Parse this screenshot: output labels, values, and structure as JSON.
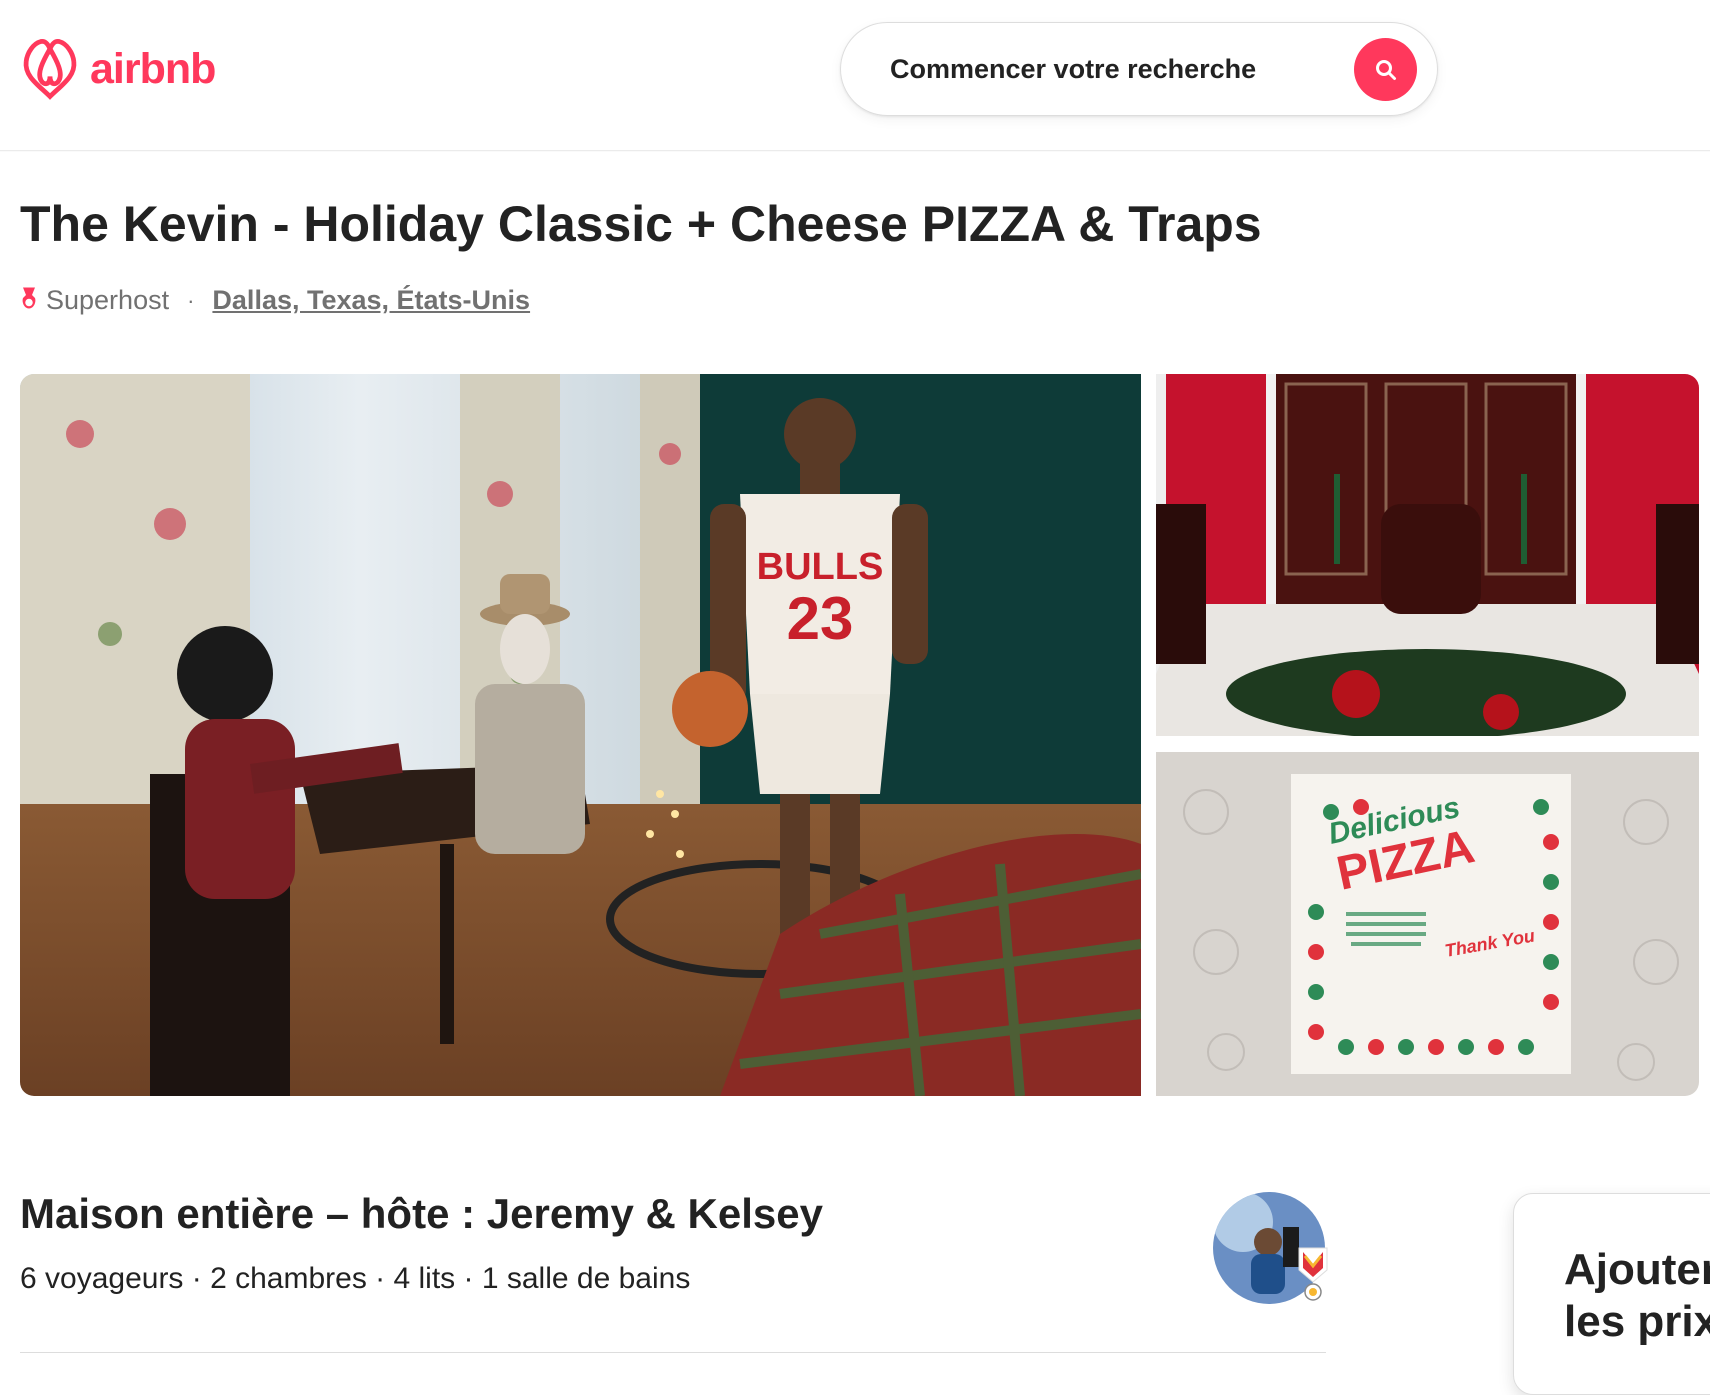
{
  "header": {
    "logo_text": "airbnb",
    "search_label": "Commencer votre recherche"
  },
  "listing": {
    "title": "The Kevin - Holiday Classic + Cheese PIZZA & Traps",
    "superhost_label": "Superhost",
    "separator": "·",
    "location": "Dallas, Texas, États-Unis"
  },
  "photos": {
    "pizza_box": {
      "brand_line1": "Delicious",
      "brand_line2": "PIZZA",
      "thank_you": "Thank You"
    },
    "jersey": {
      "team": "BULLS",
      "number": "23"
    }
  },
  "summary": {
    "title": "Maison entière – hôte : Jeremy & Kelsey",
    "details": "6 voyageurs · 2 chambres · 4 lits · 1 salle de bains"
  },
  "price_card": {
    "text": "Ajouter\nles prix"
  },
  "colors": {
    "brand": "#ff385c",
    "text": "#222222",
    "muted": "#717171",
    "border": "#dddddd"
  },
  "icons": {
    "logo": "airbnb-belo-icon",
    "search": "search-icon",
    "superhost": "superhost-ribbon-icon",
    "host_badge": "superhost-badge-icon"
  }
}
